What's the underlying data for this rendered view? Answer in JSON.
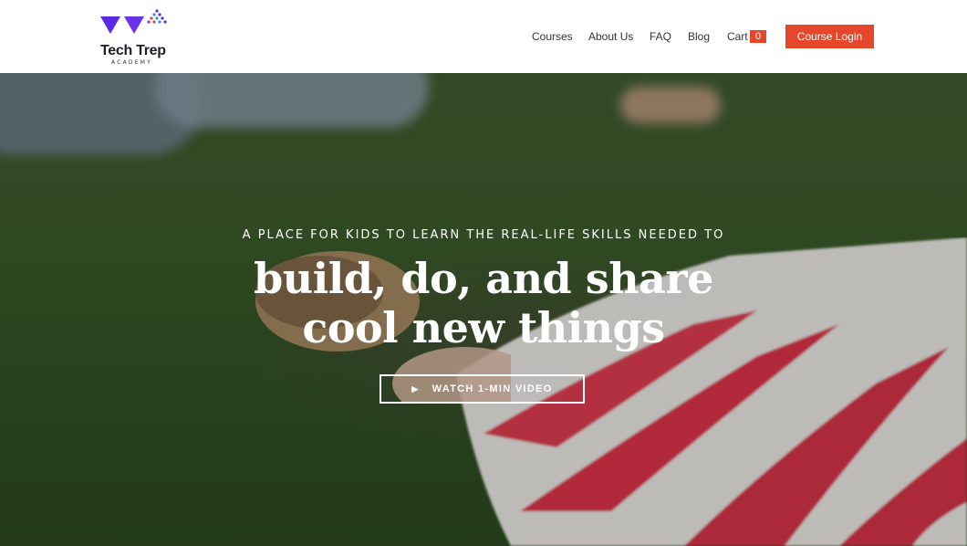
{
  "brand": {
    "name": "Tech Trep",
    "tagline": "ACADEMY",
    "accent": "#e5472b",
    "logo_colors": [
      "#5a2be2",
      "#7a3ff0",
      "#2a8cf5",
      "#e5472b"
    ]
  },
  "nav": {
    "items": [
      {
        "label": "Courses"
      },
      {
        "label": "About Us"
      },
      {
        "label": "FAQ"
      },
      {
        "label": "Blog"
      },
      {
        "label": "Cart"
      }
    ],
    "cart_count": "0",
    "login_label": "Course Login"
  },
  "hero": {
    "tagline": "A PLACE FOR KIDS TO LEARN THE REAL-LIFE SKILLS NEEDED TO",
    "headline_line1": "build, do, and share",
    "headline_line2": "cool new things",
    "video_button_label": "WATCH 1-MIN VIDEO",
    "video_button_icon": "play-icon"
  }
}
